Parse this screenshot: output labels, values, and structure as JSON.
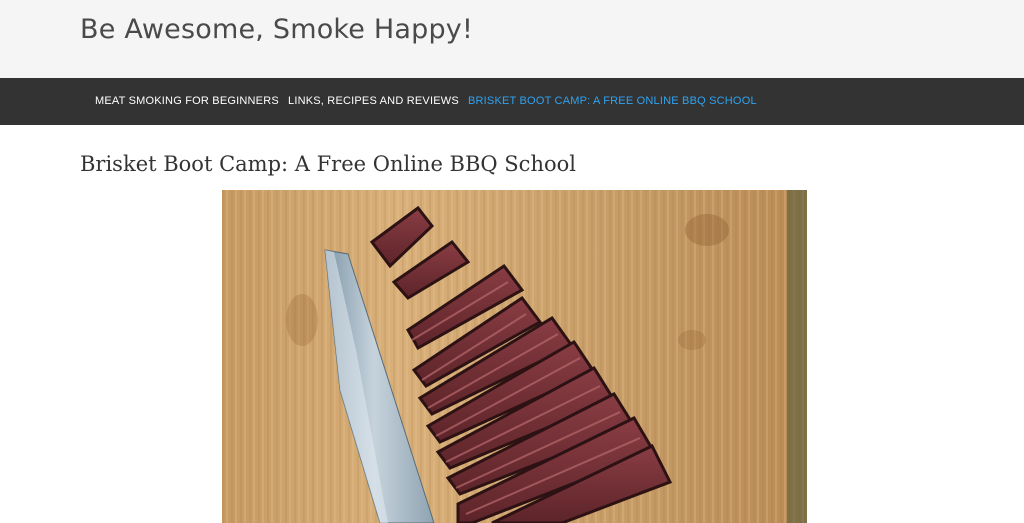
{
  "site": {
    "title": "Be Awesome, Smoke Happy!"
  },
  "nav": {
    "items": [
      {
        "label": "MEAT SMOKING FOR BEGINNERS",
        "active": false
      },
      {
        "label": "LINKS, RECIPES AND REVIEWS",
        "active": false
      },
      {
        "label": "BRISKET BOOT CAMP: A FREE ONLINE BBQ SCHOOL",
        "active": true
      }
    ],
    "active_color": "#2ea3f2",
    "bar_color": "#333333"
  },
  "page": {
    "title": "Brisket Boot Camp: A Free Online BBQ School"
  },
  "hero_image": {
    "subject": "sliced smoked meat with a chef knife on a wooden cutting board"
  }
}
